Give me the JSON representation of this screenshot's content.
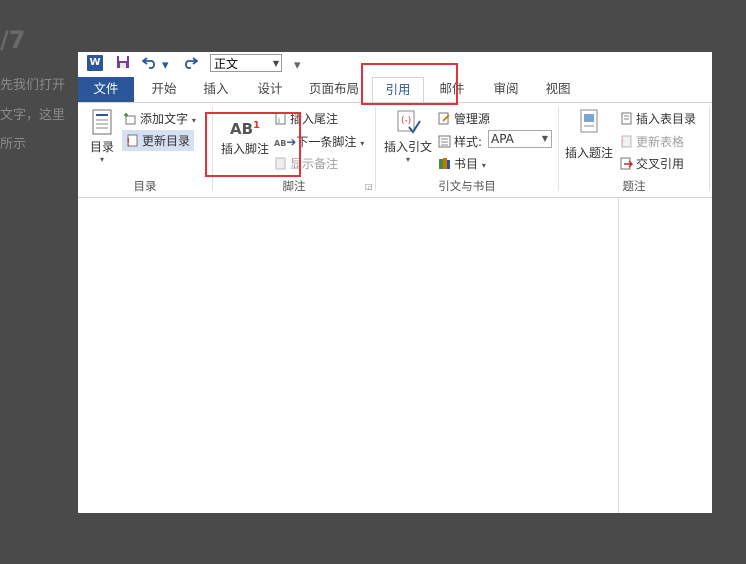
{
  "background": {
    "number": "/7",
    "lines": [
      "先我们打开",
      "文字，这里",
      "所示"
    ]
  },
  "qat": {
    "word_icon": "W",
    "style_value": "正文"
  },
  "tabs": [
    {
      "label": "文件"
    },
    {
      "label": "开始"
    },
    {
      "label": "插入"
    },
    {
      "label": "设计"
    },
    {
      "label": "页面布局"
    },
    {
      "label": "引用"
    },
    {
      "label": "邮件"
    },
    {
      "label": "审阅"
    },
    {
      "label": "视图"
    }
  ],
  "ribbon": {
    "toc": {
      "toc_button": "目录",
      "add_text": "添加文字",
      "update_toc": "更新目录",
      "group_label": "目录"
    },
    "footnotes": {
      "icon_text": "AB",
      "superscript": "1",
      "insert_footnote": "插入脚注",
      "insert_endnote": "插入尾注",
      "next_footnote": "下一条脚注",
      "show_notes": "显示备注",
      "small_icon_text": "AB",
      "group_label": "脚注"
    },
    "citations": {
      "insert_citation": "插入引文",
      "manage_sources": "管理源",
      "style_label": "样式:",
      "style_value": "APA",
      "bibliography": "书目",
      "group_label": "引文与书目"
    },
    "captions": {
      "insert_caption": "插入题注",
      "insert_table_of_figures": "插入表目录",
      "update_table": "更新表格",
      "cross_reference": "交叉引用",
      "group_label": "题注"
    }
  },
  "colors": {
    "accent": "#2b579a",
    "highlight": "#e0343a"
  }
}
